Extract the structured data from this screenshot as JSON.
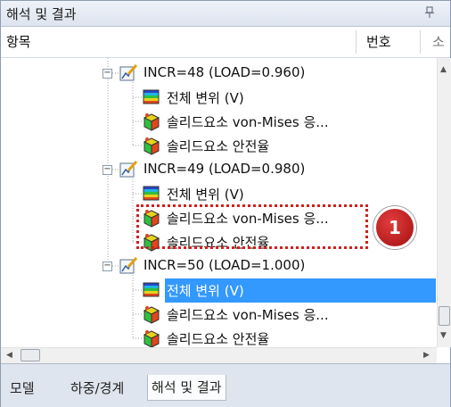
{
  "panel": {
    "title": "해석 및 결과",
    "pin_icon": "pin-icon"
  },
  "header": {
    "col_item": "항목",
    "col_number": "번호",
    "col_partial": "소"
  },
  "tree": [
    {
      "type": "incr",
      "label": "INCR=48 (LOAD=0.960)"
    },
    {
      "type": "disp",
      "label": "전체 변위 (V)"
    },
    {
      "type": "stress",
      "label": "솔리드요소 von-Mises 응..."
    },
    {
      "type": "stress",
      "label": "솔리드요소 안전율"
    },
    {
      "type": "incr",
      "label": "INCR=49 (LOAD=0.980)"
    },
    {
      "type": "disp",
      "label": "전체 변위 (V)"
    },
    {
      "type": "stress",
      "label": "솔리드요소 von-Mises 응..."
    },
    {
      "type": "stress",
      "label": "솔리드요소 안전율"
    },
    {
      "type": "incr",
      "label": "INCR=50 (LOAD=1.000)"
    },
    {
      "type": "disp",
      "label": "전체 변위 (V)",
      "selected": true
    },
    {
      "type": "stress",
      "label": "솔리드요소 von-Mises 응..."
    },
    {
      "type": "stress",
      "label": "솔리드요소 안전율"
    }
  ],
  "callout": {
    "number": "1",
    "color": "#d21f1f"
  },
  "tabs": [
    {
      "label": "모델",
      "active": false
    },
    {
      "label": "하중/경계",
      "active": false
    },
    {
      "label": "해석 및 결과",
      "active": true
    }
  ],
  "colors": {
    "selection": "#3399ff",
    "badge": "#c21a1a"
  }
}
